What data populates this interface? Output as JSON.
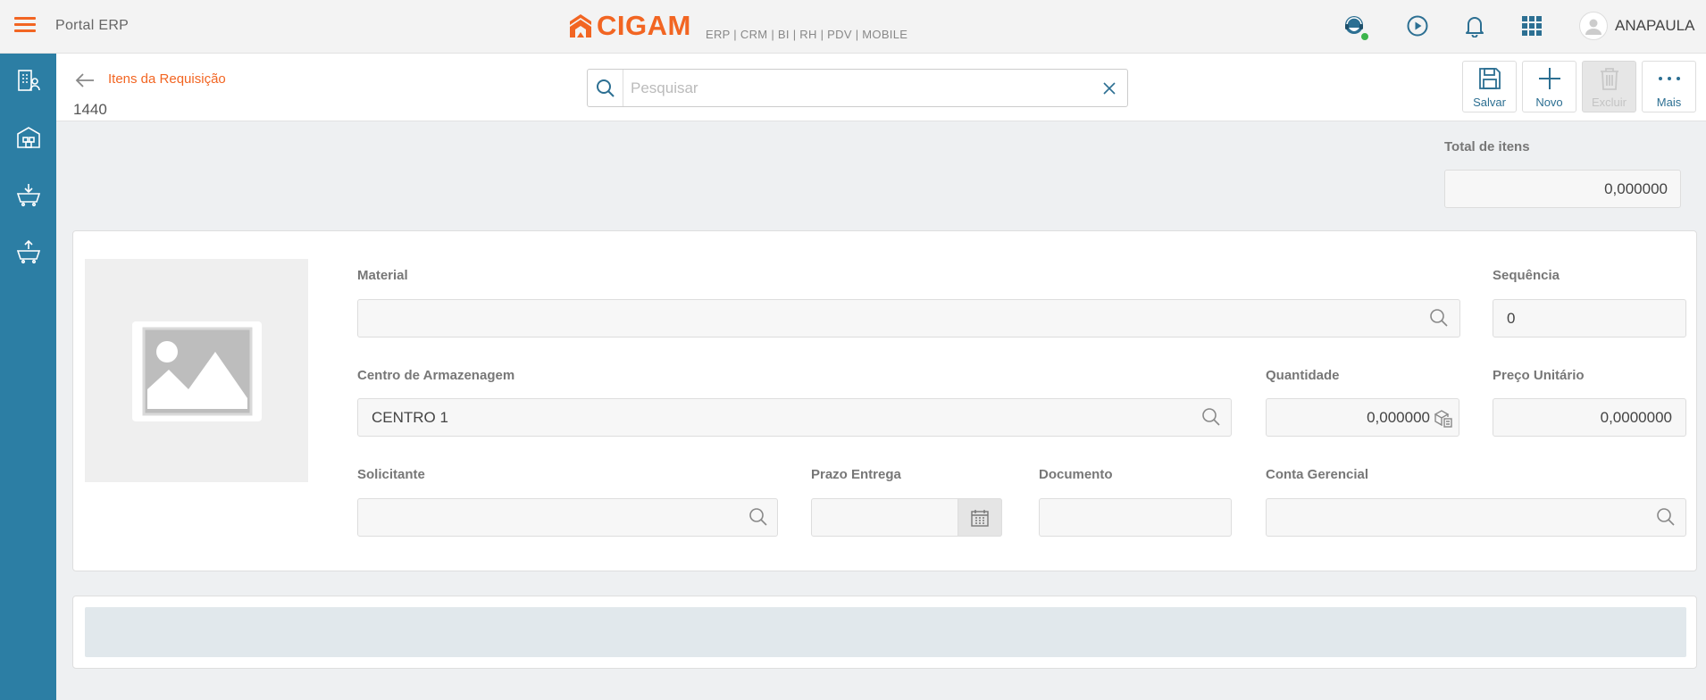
{
  "topbar": {
    "app_title": "Portal ERP",
    "logo_text": "CIGAM",
    "logo_sub": "ERP | CRM | BI | RH | PDV | MOBILE",
    "user_name": "ANAPAULA",
    "brand_color": "#f26522",
    "icons": [
      "menu-icon",
      "support-agent-icon",
      "play-icon",
      "bell-icon",
      "apps-grid-icon",
      "user-avatar-icon"
    ]
  },
  "sidebar": {
    "color": "#2c7ea4",
    "items": [
      "building-person-icon",
      "warehouse-icon",
      "cart-download-icon",
      "cart-upload-icon"
    ]
  },
  "header": {
    "breadcrumb": "Itens da Requisição",
    "record_id": "1440",
    "search": {
      "placeholder": "Pesquisar",
      "value": ""
    },
    "toolbar": {
      "save_label": "Salvar",
      "new_label": "Novo",
      "delete_label": "Excluir",
      "more_label": "Mais"
    }
  },
  "summary": {
    "total_label": "Total de itens",
    "total_value": "0,000000"
  },
  "form": {
    "material": {
      "label": "Material",
      "value": ""
    },
    "sequencia": {
      "label": "Sequência",
      "value": "0"
    },
    "centro": {
      "label": "Centro de Armazenagem",
      "value": "CENTRO 1"
    },
    "quantidade": {
      "label": "Quantidade",
      "value": "0,000000"
    },
    "preco": {
      "label": "Preço Unitário",
      "value": "0,0000000"
    },
    "solicitante": {
      "label": "Solicitante",
      "value": ""
    },
    "prazo": {
      "label": "Prazo Entrega",
      "value": ""
    },
    "documento": {
      "label": "Documento",
      "value": ""
    },
    "conta": {
      "label": "Conta Gerencial",
      "value": ""
    }
  }
}
